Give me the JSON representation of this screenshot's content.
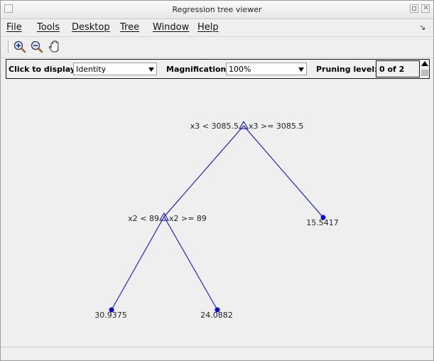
{
  "window": {
    "title": "Regression tree viewer"
  },
  "menu": {
    "items": [
      {
        "label": "File"
      },
      {
        "label": "Tools"
      },
      {
        "label": "Desktop"
      },
      {
        "label": "Tree"
      },
      {
        "label": "Window"
      },
      {
        "label": "Help"
      }
    ]
  },
  "toolbar": {
    "icons": [
      "zoom-in-icon",
      "zoom-out-icon",
      "pan-hand-icon"
    ]
  },
  "controls": {
    "display_label": "Click to display:",
    "display_value": "Identity",
    "magnification_label": "Magnification:",
    "magnification_value": "100%",
    "pruning_label": "Pruning level:",
    "pruning_value": "0 of 2"
  },
  "tree": {
    "root": {
      "left_rule": "x3 < 3085.5",
      "right_rule": "x3 >= 3085.5"
    },
    "split": {
      "left_rule": "x2 < 89",
      "right_rule": "x2 >= 89"
    },
    "leaves": [
      "30.9375",
      "24.0882",
      "15.5417"
    ]
  },
  "colors": {
    "tree_line": "#0000cc",
    "leaf_dot": "#0000ee"
  }
}
